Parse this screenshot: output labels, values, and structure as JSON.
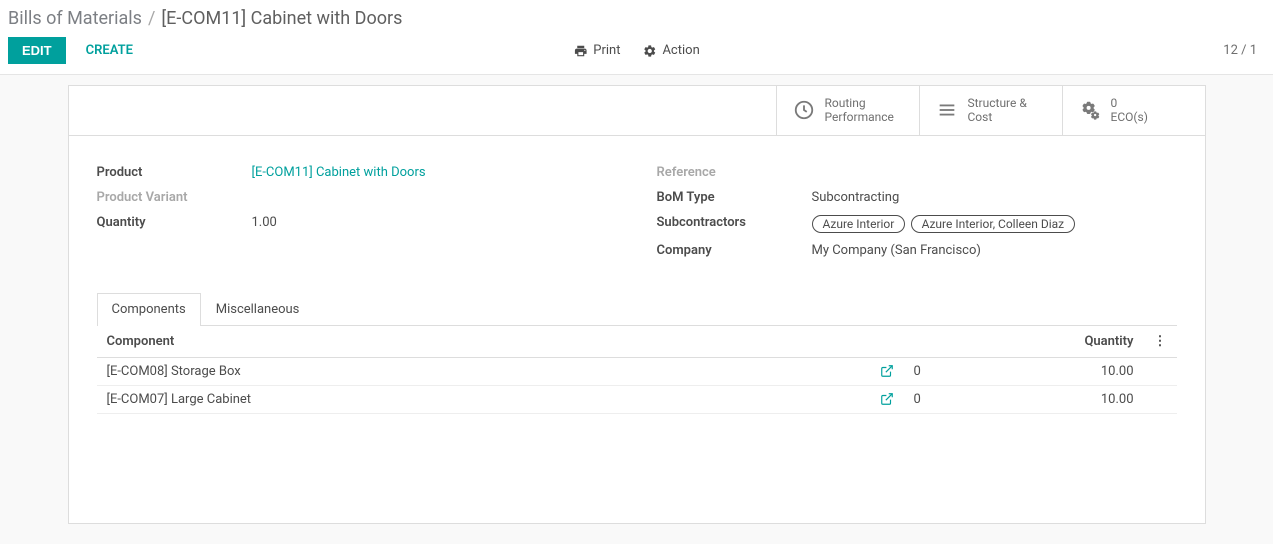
{
  "breadcrumb": {
    "root": "Bills of Materials",
    "separator": "/",
    "current": "[E-COM11] Cabinet with Doors"
  },
  "actions": {
    "edit": "EDIT",
    "create": "CREATE",
    "print": "Print",
    "action": "Action",
    "pager": "12 / 1"
  },
  "stat_buttons": {
    "routing_line1": "Routing",
    "routing_line2": "Performance",
    "structure_line1": "Structure &",
    "structure_line2": "Cost",
    "ecos_count": "0",
    "ecos_label": "ECO(s)"
  },
  "fields": {
    "left": {
      "product_label": "Product",
      "product_value": "[E-COM11] Cabinet with Doors",
      "variant_label": "Product Variant",
      "quantity_label": "Quantity",
      "quantity_value": "1.00"
    },
    "right": {
      "reference_label": "Reference",
      "bom_type_label": "BoM Type",
      "bom_type_value": "Subcontracting",
      "subcontractors_label": "Subcontractors",
      "subcontractor_tags": [
        "Azure Interior",
        "Azure Interior, Colleen Diaz"
      ],
      "company_label": "Company",
      "company_value": "My Company (San Francisco)"
    }
  },
  "tabs": {
    "components": "Components",
    "misc": "Miscellaneous"
  },
  "table": {
    "header_component": "Component",
    "header_quantity": "Quantity",
    "rows": [
      {
        "name": "[E-COM08] Storage Box",
        "mid": "0",
        "qty": "10.00"
      },
      {
        "name": "[E-COM07] Large Cabinet",
        "mid": "0",
        "qty": "10.00"
      }
    ]
  }
}
